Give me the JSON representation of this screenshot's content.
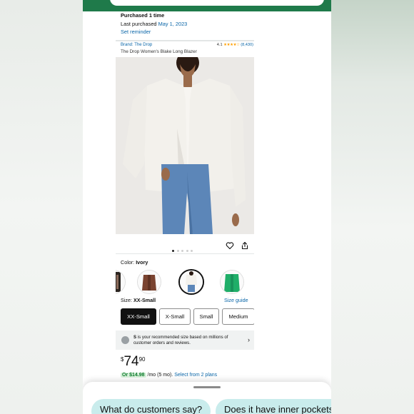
{
  "purchase": {
    "count_text": "Purchased 1 time",
    "last_label": "Last purchased",
    "last_date": "May 1, 2023",
    "reminder": "Set reminder"
  },
  "product": {
    "brand": "Brand: The Drop",
    "rating_value": "4.1",
    "rating_stars": "★★★★☆",
    "rating_count": "(8,430)",
    "title": "The Drop Women's Blake Long Blazer",
    "image_index": 0,
    "image_count": 5
  },
  "color": {
    "label": "Color:",
    "value": "Ivory",
    "selected_index": 2
  },
  "size": {
    "label": "Size:",
    "value": "XX-Small",
    "guide": "Size guide",
    "options": [
      "XX-Small",
      "X-Small",
      "Small",
      "Medium"
    ]
  },
  "recommendation": {
    "size": "S",
    "text": " is your recommended size based on millions of customer orders and reviews."
  },
  "price": {
    "currency": "$",
    "whole": "74",
    "fraction": "90"
  },
  "monthly": {
    "prefix": "Or",
    "amount": "$14.98",
    "term": "/mo (5 mo).",
    "plans": "Select from 2 plans"
  },
  "chips": [
    "What do customers say?",
    "Does it have inner pockets?"
  ],
  "colors": {
    "topbar": "#1f7a4a",
    "link": "#0a66a8",
    "chip": "#c9ecec",
    "star": "#ff9f00",
    "badge_bg": "#d9f2dc",
    "badge_fg": "#0b7a2a"
  }
}
